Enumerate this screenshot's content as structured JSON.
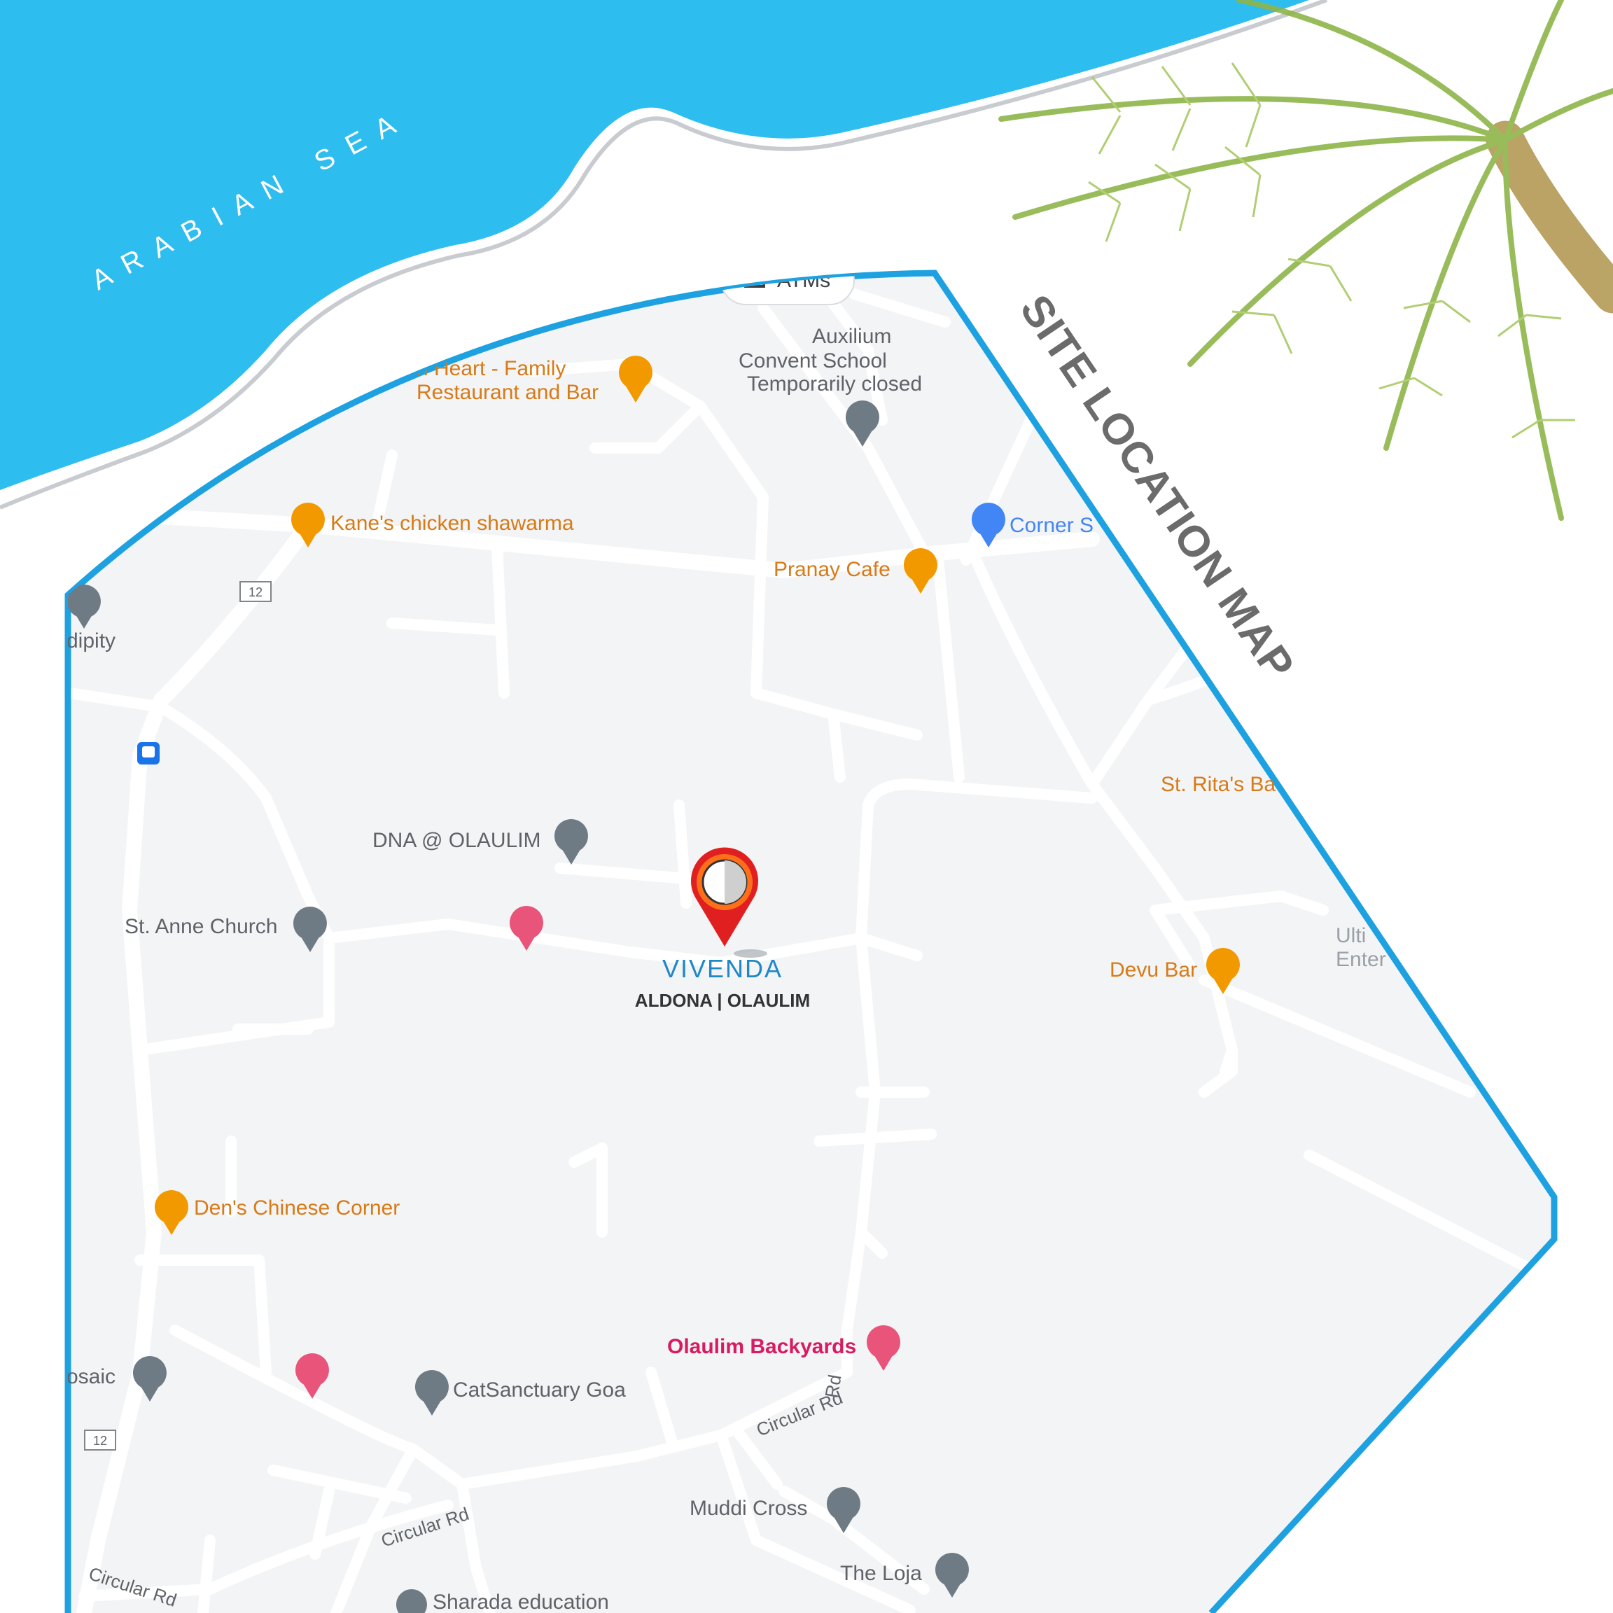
{
  "sea": {
    "label": "A R A B I A N   S E A",
    "color": "#2dbdef"
  },
  "title": "SITE LOCATION MAP",
  "frame_color": "#1da1e0",
  "site": {
    "name": "VIVENDA",
    "subtitle": "ALDONA | OLAULIM",
    "pin_color": "#e02020"
  },
  "map": {
    "top_chip": "ATMs",
    "pois": [
      {
        "name": "n Heart - Family",
        "line2": "Restaurant and Bar",
        "type": "restaurant"
      },
      {
        "name": "Auxilium",
        "line2": "Convent School",
        "note": "Temporarily closed",
        "type": "school"
      },
      {
        "name": "Kane's chicken shawarma",
        "type": "restaurant"
      },
      {
        "name": "Corner S",
        "type": "shop"
      },
      {
        "name": "Pranay Cafe",
        "type": "restaurant"
      },
      {
        "name": "dipity",
        "type": "place"
      },
      {
        "name": "St. Rita's Ba",
        "type": "restaurant"
      },
      {
        "name": "DNA @ OLAULIM",
        "type": "place"
      },
      {
        "name": "St. Anne Church",
        "type": "church"
      },
      {
        "name": "Devu Bar",
        "type": "restaurant"
      },
      {
        "name": "Ulti",
        "line2": "Enter",
        "type": "place"
      },
      {
        "name": "Den's Chinese Corner",
        "type": "restaurant"
      },
      {
        "name": "Olaulim Backyards",
        "type": "hotel"
      },
      {
        "name": "osaic",
        "type": "place"
      },
      {
        "name": "CatSanctuary Goa",
        "type": "place"
      },
      {
        "name": "Muddi Cross",
        "type": "church"
      },
      {
        "name": "The Loja",
        "type": "place"
      },
      {
        "name": "Sharada education",
        "type": "place"
      }
    ],
    "roads": [
      "Circular Rd",
      "Circular Rd",
      "Circular Rd"
    ],
    "route_badges": [
      "12",
      "12"
    ],
    "colors": {
      "restaurant": "#f29900",
      "hotel": "#e8547a",
      "place": "#6e7b85",
      "shop": "#4285f4"
    }
  }
}
